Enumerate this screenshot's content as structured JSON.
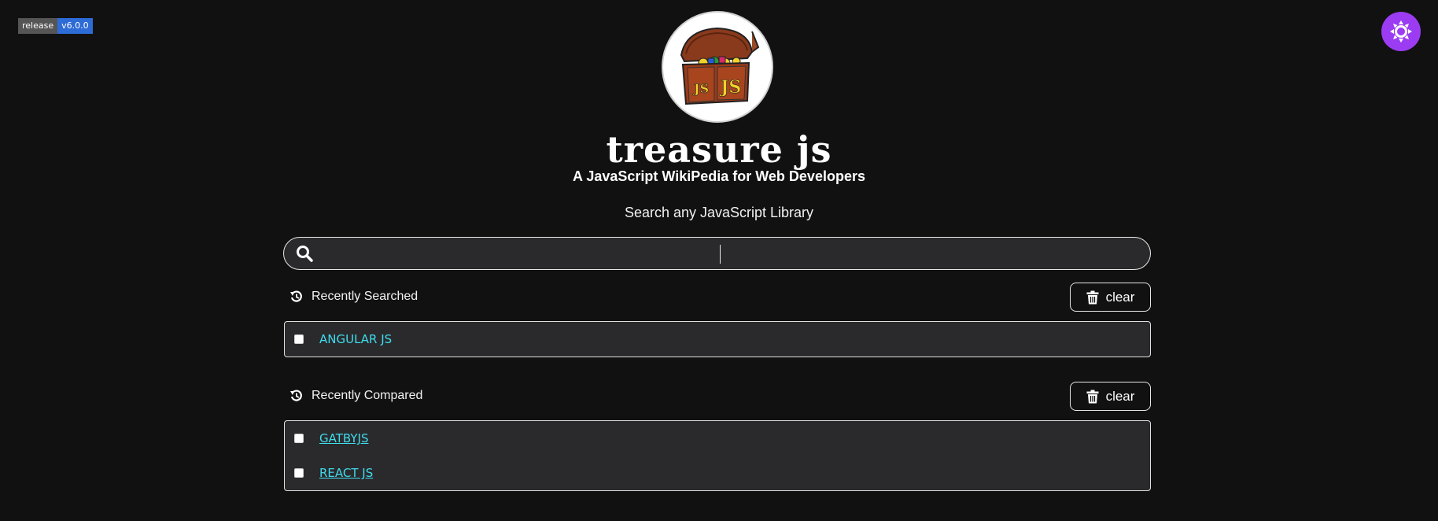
{
  "badge": {
    "label": "release",
    "version": "v6.0.0"
  },
  "header": {
    "title": "treasure js",
    "subtitle": "A JavaScript WikiPedia for Web Developers",
    "search_label": "Search any JavaScript Library"
  },
  "search": {
    "value": "",
    "placeholder": ""
  },
  "recently_searched": {
    "heading": "Recently Searched",
    "clear_label": "clear",
    "items": [
      {
        "label": "ANGULAR JS"
      }
    ]
  },
  "recently_compared": {
    "heading": "Recently Compared",
    "clear_label": "clear",
    "items": [
      {
        "label": "GATBYJS"
      },
      {
        "label": "REACT JS"
      }
    ]
  },
  "colors": {
    "background": "#111111",
    "accent_link": "#3fdcec",
    "theme_button": "#9b3cf2",
    "badge_version": "#2d6bd6"
  },
  "icons": {
    "search": "search-icon",
    "history": "history-icon",
    "trash": "trash-icon",
    "theme": "sun-icon"
  }
}
